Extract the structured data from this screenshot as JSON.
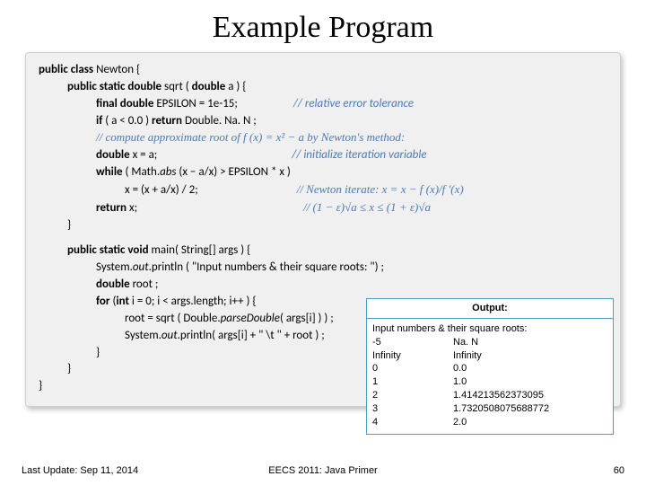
{
  "slide": {
    "title": "Example Program"
  },
  "code": {
    "l1_kw1": "public  class",
    "l1_name": " Newton {",
    "l2_kw": "public  static  double",
    "l2_sig": "  sqrt ( ",
    "l2_kw2": "double",
    "l2_sig2": " a )  {",
    "l3_kw": "final double",
    "l3_body": " EPSILON = 1e-15;",
    "l3_cm": "//  relative error tolerance",
    "l4_kw": "if",
    "l4_body": "   ( a  <  0.0 )   ",
    "l4_kw2": "return",
    "l4_body2": " Double. Na. N ;",
    "l5_cm": "//  compute approximate root of    f (x)  =  x²  −  a    by Newton's method:",
    "l6_kw": "double",
    "l6_body": " x = a;",
    "l6_cm": "//  initialize iteration variable",
    "l7_kw": "while",
    "l7_body": "   ( Math.",
    "l7_it": "abs",
    "l7_body2": " (x − a/x)   >   EPSILON * x )",
    "l8_body": "x = (x + a/x) / 2;",
    "l8_cm": "// Newton iterate:    x  =  x  −  f (x)/f '(x)",
    "l9_kw": "return",
    "l9_body": " x;",
    "l9_cm": "//    (1 − ε)√a  ≤  x  ≤  (1 + ε)√a",
    "l10": "}",
    "l12_kw": "public  static  void",
    "l12_sig": "   main(  String[]  args )    {",
    "l13_body": "System.",
    "l13_it": "out",
    "l13_body2": ".println  ( \"Input numbers & their square roots: \") ;",
    "l14_kw": "double",
    "l14_body": "  root ;",
    "l15_kw": "for",
    "l15_body": " (",
    "l15_kw2": "int",
    "l15_body2": " i = 0;   i  <  args.length;   i++ )  {",
    "l16_body": "root =  sqrt (  Double.",
    "l16_it": "parseDouble",
    "l16_body2": "( args[i] )  ) ;",
    "l17_body": "System.",
    "l17_it": "out",
    "l17_body2": ".println(  args[i]   +  \" \\t \"  +   root ) ;",
    "l18": "}",
    "l19": "}",
    "l20": "}"
  },
  "output": {
    "title": "Output:",
    "header": "Input numbers & their square roots:",
    "rows": [
      {
        "in": "-5",
        "out": "Na. N"
      },
      {
        "in": "Infinity",
        "out": "Infinity"
      },
      {
        "in": "0",
        "out": "0.0"
      },
      {
        "in": "1",
        "out": "1.0"
      },
      {
        "in": "2",
        "out": "1.414213562373095"
      },
      {
        "in": "3",
        "out": "1.7320508075688772"
      },
      {
        "in": "4",
        "out": "2.0"
      }
    ]
  },
  "footer": {
    "left": "Last Update: Sep 11, 2014",
    "center": "EECS 2011: Java Primer",
    "right": "60"
  }
}
